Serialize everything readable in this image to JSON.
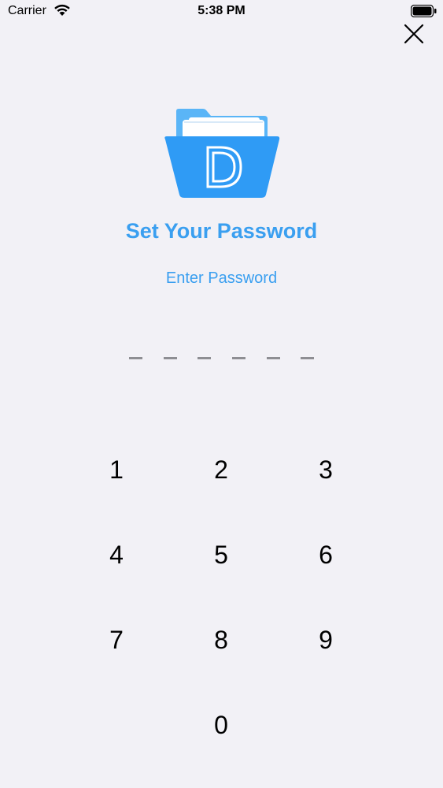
{
  "status_bar": {
    "carrier": "Carrier",
    "time": "5:38 PM"
  },
  "logo": {
    "letter": "D",
    "icon": "folder-icon"
  },
  "title": "Set Your Password",
  "subtitle": "Enter Password",
  "pin": {
    "length": 6
  },
  "keypad": {
    "keys": [
      "1",
      "2",
      "3",
      "4",
      "5",
      "6",
      "7",
      "8",
      "9",
      "0"
    ]
  },
  "colors": {
    "accent": "#3a9ff0",
    "background": "#f2f1f6",
    "dash": "#8e8e93"
  }
}
